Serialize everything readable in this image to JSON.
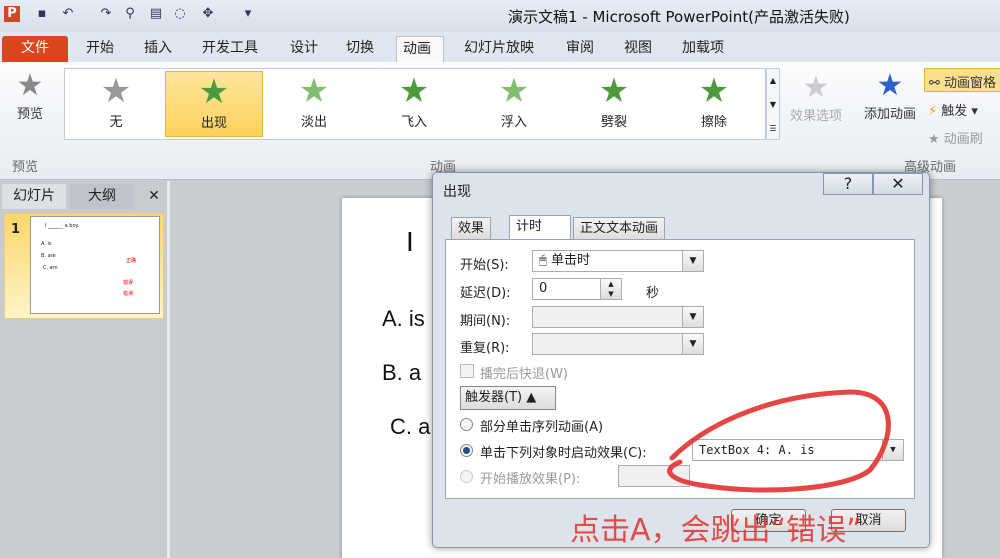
{
  "window": {
    "title": "演示文稿1 - Microsoft PowerPoint(产品激活失败)"
  },
  "quick_access": [
    "save-icon",
    "undo-icon",
    "redo-icon",
    "find-icon",
    "paste-icon",
    "refresh-icon",
    "pointer-icon",
    "customize-icon"
  ],
  "tabs": [
    {
      "label": "文件"
    },
    {
      "label": "开始"
    },
    {
      "label": "插入"
    },
    {
      "label": "开发工具"
    },
    {
      "label": "设计"
    },
    {
      "label": "切换"
    },
    {
      "label": "动画"
    },
    {
      "label": "幻灯片放映"
    },
    {
      "label": "审阅"
    },
    {
      "label": "视图"
    },
    {
      "label": "加载项"
    }
  ],
  "ribbon": {
    "preview": {
      "button": "预览",
      "group": "预览"
    },
    "animations": {
      "group": "动画",
      "items": [
        {
          "label": "无"
        },
        {
          "label": "出现"
        },
        {
          "label": "淡出"
        },
        {
          "label": "飞入"
        },
        {
          "label": "浮入"
        },
        {
          "label": "劈裂"
        },
        {
          "label": "擦除"
        }
      ],
      "effect_options": "效果选项"
    },
    "advanced": {
      "group": "高级动画",
      "add_animation": "添加动画",
      "animation_pane": "动画窗格",
      "trigger": "触发",
      "painter": "动画刷"
    }
  },
  "left_panel": {
    "tabs": [
      "幻灯片",
      "大纲"
    ],
    "close": "✕",
    "slide_number": "1",
    "thumb": {
      "line1": "I ______ a boy.",
      "a": "A. is",
      "b": "B. are",
      "c": "C. am",
      "r1": "正确",
      "r2": "错误",
      "r3": "错误"
    }
  },
  "slide": {
    "title": "I",
    "a": "A.  is",
    "b": "B.  a",
    "c": "C.  a"
  },
  "dialog": {
    "title": "出现",
    "help": "?",
    "close": "✕",
    "tabs": [
      "效果",
      "计时",
      "正文文本动画"
    ],
    "start_label": "开始(S):",
    "start_value": "单击时",
    "delay_label": "延迟(D):",
    "delay_value": "0",
    "delay_unit": "秒",
    "duration_label": "期间(N):",
    "repeat_label": "重复(R):",
    "rewind_label": "播完后快退(W)",
    "triggers_button": "触发器(T) ▲",
    "radio1": "部分单击序列动画(A)",
    "radio2": "单击下列对象时启动效果(C):",
    "radio2_value": "TextBox 4: A.  is",
    "radio3": "开始播放效果(P):",
    "ok": "确定",
    "cancel": "取消"
  },
  "annotation": {
    "text": "点击A，会跳出“错误”",
    "color": "#e2322f"
  }
}
